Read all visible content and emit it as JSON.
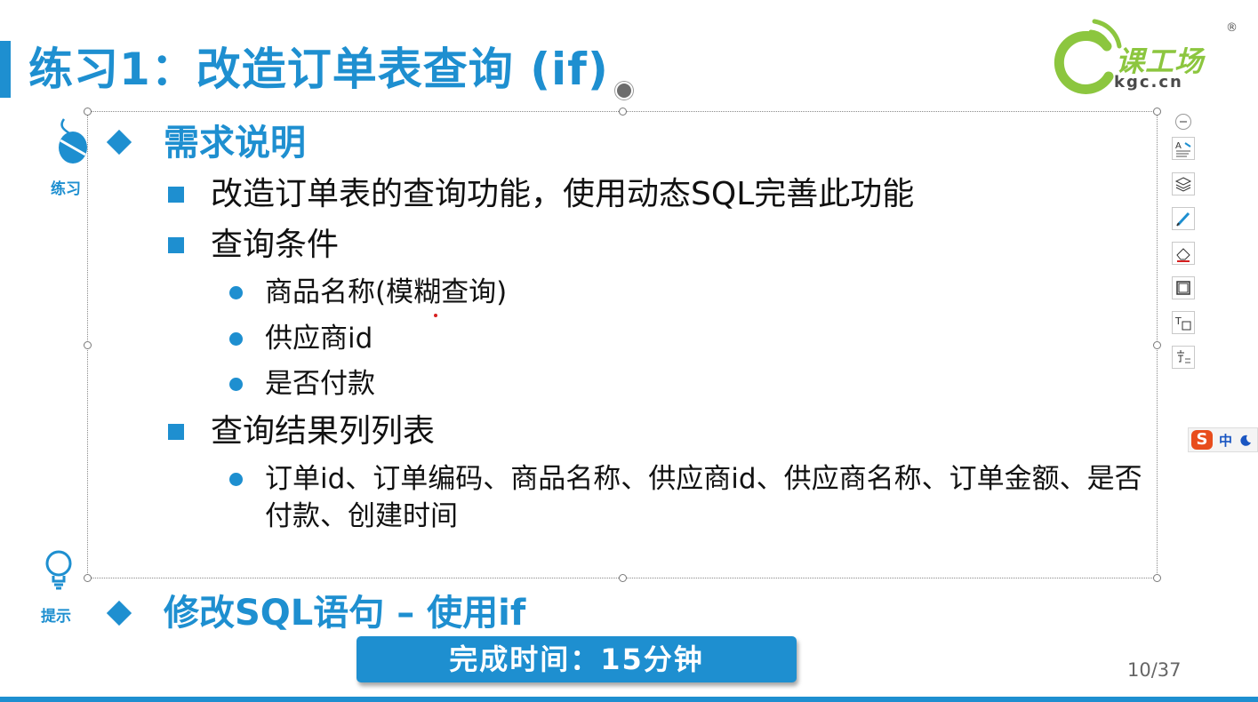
{
  "slide": {
    "title": "练习1：改造订单表查询 (if)",
    "logo": {
      "text": "课工场",
      "sub": "kgc.cn",
      "reg": "®"
    },
    "side_labels": {
      "practice": "练习",
      "hint": "提示"
    },
    "content": {
      "heading": "需求说明",
      "items": [
        {
          "text": "改造订单表的查询功能，使用动态SQL完善此功能"
        },
        {
          "text": "查询条件",
          "subitems": [
            "商品名称(模糊查询)",
            "供应商id",
            "是否付款"
          ]
        },
        {
          "text": "查询结果列列表",
          "subitems": [
            "订单id、订单编码、商品名称、供应商id、供应商名称、订单金额、是否付款、创建时间"
          ]
        }
      ]
    },
    "hint": "修改SQL语句 – 使用if",
    "time_bar": "完成时间：15分钟",
    "page_number": "10/37"
  },
  "toolbar": {
    "collapse_icon": "minus-circle-icon",
    "buttons": [
      "text-format-icon",
      "layers-icon",
      "pen-icon",
      "eraser-icon",
      "frame-icon",
      "text-box-icon",
      "font-icon"
    ]
  },
  "ime": {
    "logo": "S",
    "mode": "中"
  },
  "colors": {
    "accent": "#1e8fd0",
    "logo_green": "#8cc63f"
  }
}
